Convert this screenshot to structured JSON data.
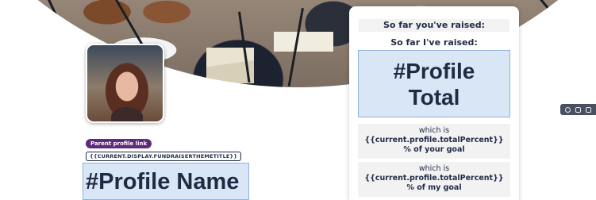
{
  "profile": {
    "parent_link_label": "Parent profile link",
    "theme_title": "{{CURRENT.DISPLAY.FUNDRAISERTHEMETITLE}}",
    "name": "#Profile Name"
  },
  "panel": {
    "raised_you": "So far you've raised:",
    "raised_i": "So far I've raised:",
    "total_line1": "#Profile",
    "total_line2": "Total",
    "goal_your": {
      "prefix": "which is",
      "expr": "{{current.profile.totalPercent}}",
      "suffix": "% of your goal"
    },
    "goal_my": {
      "prefix": "which is",
      "expr": "{{current.profile.totalPercent}}",
      "suffix": "% of my goal"
    }
  },
  "toolbar": {
    "icons": [
      "settings-icon",
      "copy-icon",
      "delete-icon"
    ]
  },
  "colors": {
    "navy_text": "#1f2a44",
    "purple_badge": "#5e2a7a",
    "highlight_fill": "#d9e6f6",
    "highlight_border": "#8fb2de"
  }
}
